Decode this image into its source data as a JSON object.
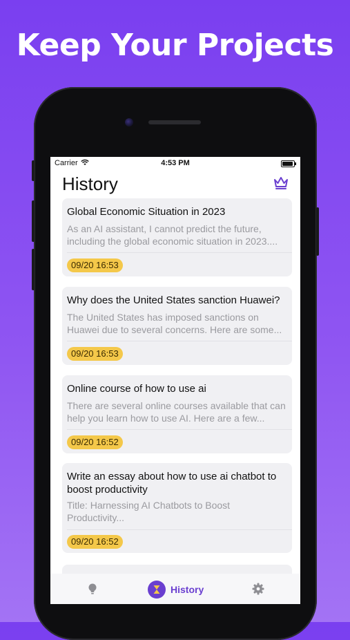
{
  "headline": "Keep Your Projects",
  "status_bar": {
    "carrier": "Carrier",
    "time": "4:53 PM"
  },
  "screen": {
    "title": "History"
  },
  "icons": {
    "premium": "crown-icon",
    "wifi": "wifi-icon",
    "battery": "battery-icon",
    "tab_ideas": "lightbulb-icon",
    "tab_history": "hourglass-icon",
    "tab_settings": "gear-icon"
  },
  "history": [
    {
      "title": "Global Economic Situation in 2023",
      "preview": "As an AI assistant, I cannot predict the future, including the global economic situation in 2023....",
      "timestamp": "09/20 16:53"
    },
    {
      "title": "Why does the United States sanction Huawei?",
      "preview": "The United States has imposed sanctions on Huawei due to several concerns. Here are some...",
      "timestamp": "09/20 16:53"
    },
    {
      "title": "Online course of how to use ai",
      "preview": "There are several online courses available that can help you learn how to use AI. Here are a few...",
      "timestamp": "09/20 16:52"
    },
    {
      "title": "Write an essay about how to use ai chatbot to boost productivity",
      "preview": "Title: Harnessing AI Chatbots to Boost Productivity...",
      "timestamp": "09/20 16:52"
    }
  ],
  "tabbar": {
    "active_label": "History"
  },
  "colors": {
    "accent": "#6a3fd0",
    "badge": "#f4c84a",
    "background_top": "#7a3ff0",
    "background_bottom": "#a373f4"
  }
}
